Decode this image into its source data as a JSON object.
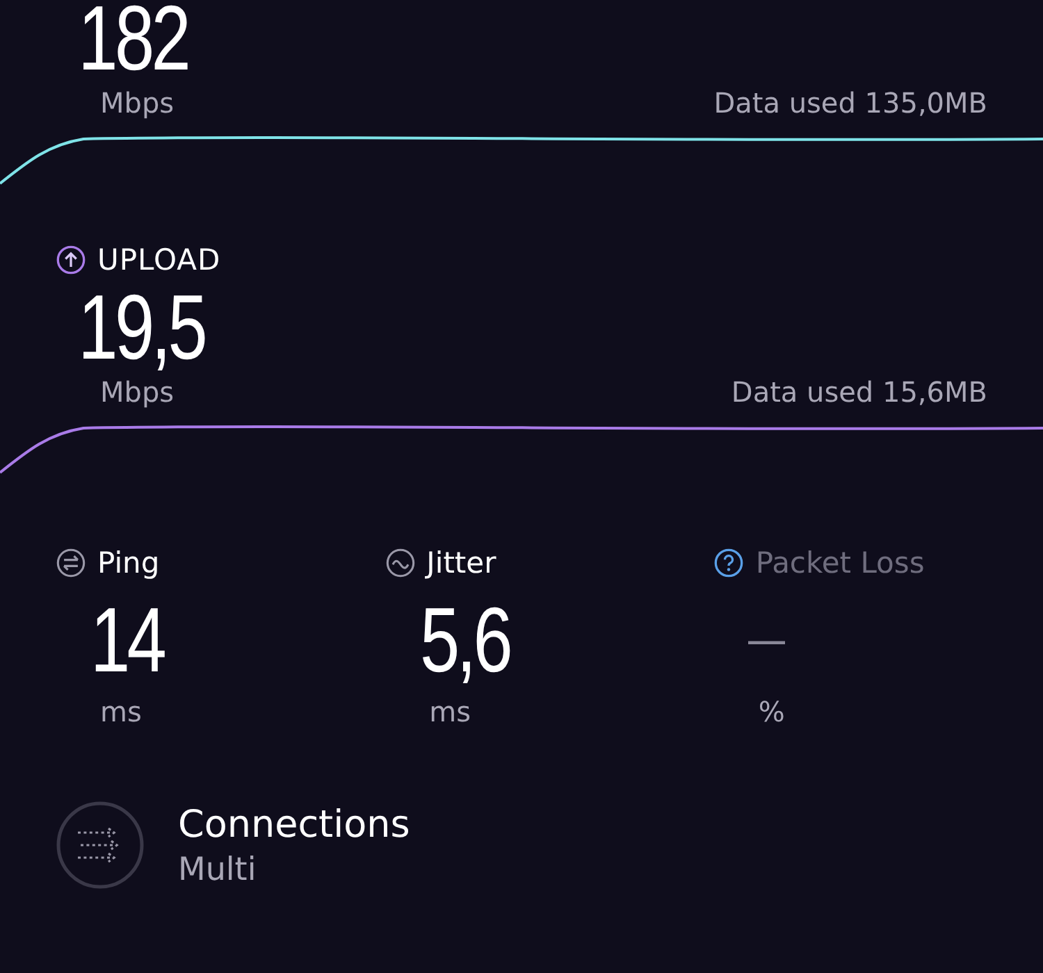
{
  "speeds": [
    {
      "kind": "download",
      "value": "182",
      "unit": "Mbps",
      "data_used": "Data used 135,0MB"
    },
    {
      "kind": "upload",
      "label": "UPLOAD",
      "value": "19,5",
      "unit": "Mbps",
      "data_used": "Data used 15,6MB"
    }
  ],
  "metrics": [
    {
      "kind": "ping",
      "label": "Ping",
      "muted": false,
      "value": "14",
      "unit": "ms"
    },
    {
      "kind": "jitter",
      "label": "Jitter",
      "muted": false,
      "value": "5,6",
      "unit": "ms"
    },
    {
      "kind": "packet_loss",
      "label": "Packet Loss",
      "muted": true,
      "value": "—",
      "unit": "%"
    }
  ],
  "connections": {
    "title": "Connections",
    "value": "Multi"
  }
}
